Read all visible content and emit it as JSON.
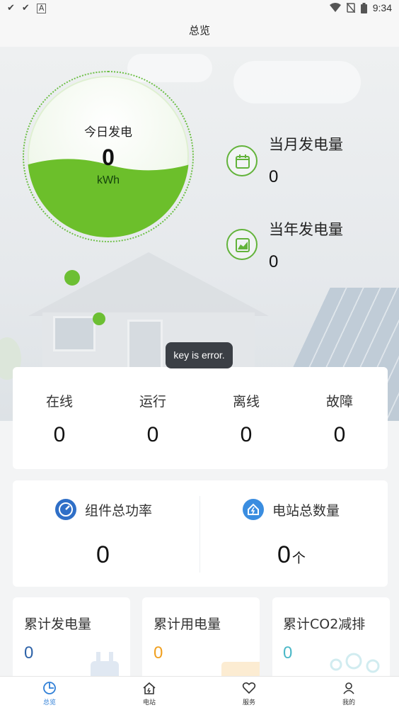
{
  "status_bar": {
    "time": "9:34",
    "left_icons": [
      "check-icon",
      "check-icon",
      "a-icon"
    ],
    "right_icons": [
      "wifi-icon",
      "no-sim-icon",
      "battery-icon"
    ]
  },
  "header": {
    "title": "总览"
  },
  "gauge": {
    "title": "今日发电",
    "value": "0",
    "unit": "kWh",
    "fill_level": 0.45
  },
  "month": {
    "title": "当月发电量",
    "value": "0",
    "icon": "calendar-icon"
  },
  "year": {
    "title": "当年发电量",
    "value": "0",
    "icon": "chart-icon"
  },
  "toast": "key is error.",
  "status": [
    {
      "label": "在线",
      "value": "0"
    },
    {
      "label": "运行",
      "value": "0"
    },
    {
      "label": "离线",
      "value": "0"
    },
    {
      "label": "故障",
      "value": "0"
    }
  ],
  "power": {
    "title": "组件总功率",
    "value": "0",
    "icon": "gauge-icon"
  },
  "stations": {
    "title": "电站总数量",
    "value": "0",
    "unit": "个",
    "icon": "home-icon"
  },
  "accumulated": [
    {
      "title": "累计发电量",
      "value": "0",
      "color": "#2e63a8"
    },
    {
      "title": "累计用电量",
      "value": "0",
      "color": "#f0a020"
    },
    {
      "title": "累计CO2减排",
      "value": "0",
      "color": "#4bb8c7"
    }
  ],
  "nav": [
    {
      "label": "总览",
      "icon": "pie-chart-icon",
      "active": true
    },
    {
      "label": "电站",
      "icon": "home-icon",
      "active": false
    },
    {
      "label": "服务",
      "icon": "heart-icon",
      "active": false
    },
    {
      "label": "我的",
      "icon": "user-icon",
      "active": false
    }
  ],
  "colors": {
    "accent": "#62b33a",
    "nav_active": "#2f7fd7",
    "power_icon": "#2f6fc7",
    "station_icon": "#3a8de0"
  }
}
